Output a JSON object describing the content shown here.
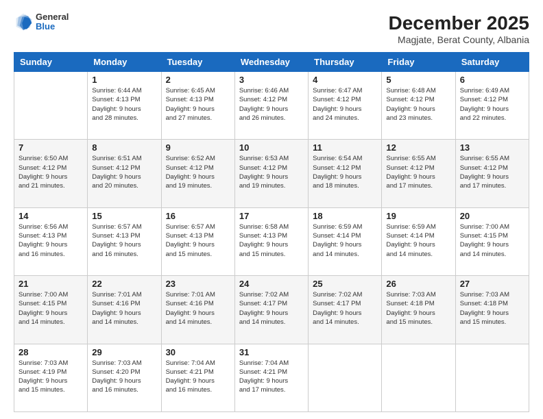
{
  "logo": {
    "general": "General",
    "blue": "Blue"
  },
  "header": {
    "title": "December 2025",
    "subtitle": "Magjate, Berat County, Albania"
  },
  "weekdays": [
    "Sunday",
    "Monday",
    "Tuesday",
    "Wednesday",
    "Thursday",
    "Friday",
    "Saturday"
  ],
  "weeks": [
    [
      {
        "day": "",
        "info": ""
      },
      {
        "day": "1",
        "info": "Sunrise: 6:44 AM\nSunset: 4:13 PM\nDaylight: 9 hours\nand 28 minutes."
      },
      {
        "day": "2",
        "info": "Sunrise: 6:45 AM\nSunset: 4:13 PM\nDaylight: 9 hours\nand 27 minutes."
      },
      {
        "day": "3",
        "info": "Sunrise: 6:46 AM\nSunset: 4:12 PM\nDaylight: 9 hours\nand 26 minutes."
      },
      {
        "day": "4",
        "info": "Sunrise: 6:47 AM\nSunset: 4:12 PM\nDaylight: 9 hours\nand 24 minutes."
      },
      {
        "day": "5",
        "info": "Sunrise: 6:48 AM\nSunset: 4:12 PM\nDaylight: 9 hours\nand 23 minutes."
      },
      {
        "day": "6",
        "info": "Sunrise: 6:49 AM\nSunset: 4:12 PM\nDaylight: 9 hours\nand 22 minutes."
      }
    ],
    [
      {
        "day": "7",
        "info": "Sunrise: 6:50 AM\nSunset: 4:12 PM\nDaylight: 9 hours\nand 21 minutes."
      },
      {
        "day": "8",
        "info": "Sunrise: 6:51 AM\nSunset: 4:12 PM\nDaylight: 9 hours\nand 20 minutes."
      },
      {
        "day": "9",
        "info": "Sunrise: 6:52 AM\nSunset: 4:12 PM\nDaylight: 9 hours\nand 19 minutes."
      },
      {
        "day": "10",
        "info": "Sunrise: 6:53 AM\nSunset: 4:12 PM\nDaylight: 9 hours\nand 19 minutes."
      },
      {
        "day": "11",
        "info": "Sunrise: 6:54 AM\nSunset: 4:12 PM\nDaylight: 9 hours\nand 18 minutes."
      },
      {
        "day": "12",
        "info": "Sunrise: 6:55 AM\nSunset: 4:12 PM\nDaylight: 9 hours\nand 17 minutes."
      },
      {
        "day": "13",
        "info": "Sunrise: 6:55 AM\nSunset: 4:12 PM\nDaylight: 9 hours\nand 17 minutes."
      }
    ],
    [
      {
        "day": "14",
        "info": "Sunrise: 6:56 AM\nSunset: 4:13 PM\nDaylight: 9 hours\nand 16 minutes."
      },
      {
        "day": "15",
        "info": "Sunrise: 6:57 AM\nSunset: 4:13 PM\nDaylight: 9 hours\nand 16 minutes."
      },
      {
        "day": "16",
        "info": "Sunrise: 6:57 AM\nSunset: 4:13 PM\nDaylight: 9 hours\nand 15 minutes."
      },
      {
        "day": "17",
        "info": "Sunrise: 6:58 AM\nSunset: 4:13 PM\nDaylight: 9 hours\nand 15 minutes."
      },
      {
        "day": "18",
        "info": "Sunrise: 6:59 AM\nSunset: 4:14 PM\nDaylight: 9 hours\nand 14 minutes."
      },
      {
        "day": "19",
        "info": "Sunrise: 6:59 AM\nSunset: 4:14 PM\nDaylight: 9 hours\nand 14 minutes."
      },
      {
        "day": "20",
        "info": "Sunrise: 7:00 AM\nSunset: 4:15 PM\nDaylight: 9 hours\nand 14 minutes."
      }
    ],
    [
      {
        "day": "21",
        "info": "Sunrise: 7:00 AM\nSunset: 4:15 PM\nDaylight: 9 hours\nand 14 minutes."
      },
      {
        "day": "22",
        "info": "Sunrise: 7:01 AM\nSunset: 4:16 PM\nDaylight: 9 hours\nand 14 minutes."
      },
      {
        "day": "23",
        "info": "Sunrise: 7:01 AM\nSunset: 4:16 PM\nDaylight: 9 hours\nand 14 minutes."
      },
      {
        "day": "24",
        "info": "Sunrise: 7:02 AM\nSunset: 4:17 PM\nDaylight: 9 hours\nand 14 minutes."
      },
      {
        "day": "25",
        "info": "Sunrise: 7:02 AM\nSunset: 4:17 PM\nDaylight: 9 hours\nand 14 minutes."
      },
      {
        "day": "26",
        "info": "Sunrise: 7:03 AM\nSunset: 4:18 PM\nDaylight: 9 hours\nand 15 minutes."
      },
      {
        "day": "27",
        "info": "Sunrise: 7:03 AM\nSunset: 4:18 PM\nDaylight: 9 hours\nand 15 minutes."
      }
    ],
    [
      {
        "day": "28",
        "info": "Sunrise: 7:03 AM\nSunset: 4:19 PM\nDaylight: 9 hours\nand 15 minutes."
      },
      {
        "day": "29",
        "info": "Sunrise: 7:03 AM\nSunset: 4:20 PM\nDaylight: 9 hours\nand 16 minutes."
      },
      {
        "day": "30",
        "info": "Sunrise: 7:04 AM\nSunset: 4:21 PM\nDaylight: 9 hours\nand 16 minutes."
      },
      {
        "day": "31",
        "info": "Sunrise: 7:04 AM\nSunset: 4:21 PM\nDaylight: 9 hours\nand 17 minutes."
      },
      {
        "day": "",
        "info": ""
      },
      {
        "day": "",
        "info": ""
      },
      {
        "day": "",
        "info": ""
      }
    ]
  ]
}
